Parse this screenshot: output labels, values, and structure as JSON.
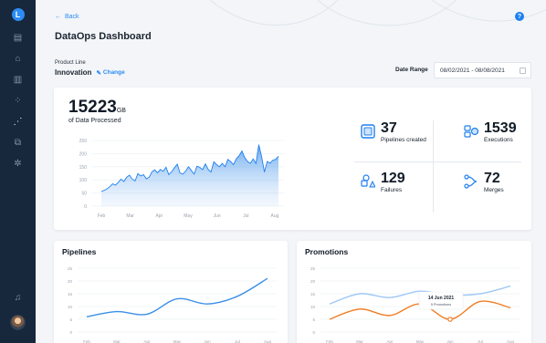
{
  "app": {
    "logo_letter": "L"
  },
  "sidebar": {
    "items": [
      {
        "icon": "document-icon",
        "glyph": "▤"
      },
      {
        "icon": "archive-icon",
        "glyph": "⌂"
      },
      {
        "icon": "analytics-icon",
        "glyph": "▥"
      },
      {
        "icon": "grid-icon",
        "glyph": "⁘"
      },
      {
        "icon": "chart-trend-icon",
        "glyph": "⋰",
        "active": true
      },
      {
        "icon": "network-icon",
        "glyph": "⧉"
      },
      {
        "icon": "settings-icon",
        "glyph": "✲"
      }
    ],
    "bottom": [
      {
        "icon": "bell-icon",
        "glyph": "♫"
      }
    ]
  },
  "header": {
    "back_label": "Back",
    "help_glyph": "?",
    "title": "DataOps Dashboard"
  },
  "filters": {
    "product_line_label": "Product Line",
    "product_line_value": "Innovation",
    "change_label": "Change",
    "date_range_label": "Date Range",
    "date_range_value": "08/02/2021 - 08/08/2021"
  },
  "summary": {
    "data_processed": "15223",
    "data_unit": "GB",
    "data_caption": "of Data Processed"
  },
  "stats": [
    {
      "value": "37",
      "label": "Pipelines created",
      "icon": "pipeline-icon"
    },
    {
      "value": "1539",
      "label": "Executions",
      "icon": "execution-icon"
    },
    {
      "value": "129",
      "label": "Failures",
      "icon": "failure-icon"
    },
    {
      "value": "72",
      "label": "Merges",
      "icon": "merge-icon"
    }
  ],
  "panels": {
    "pipelines_title": "Pipelines",
    "promotions_title": "Promotions",
    "tooltip_date": "14 Jun 2021",
    "tooltip_value": "5 Promotions"
  },
  "colors": {
    "accent": "#2c8cf4",
    "sidebar": "#17283c",
    "series_light": "#9ec9f5",
    "series_orange": "#f07e26"
  },
  "chart_data": [
    {
      "type": "area",
      "categories": [
        "Feb",
        "Mar",
        "Apr",
        "May",
        "Jun",
        "Jul",
        "Aug"
      ],
      "ylim": [
        0,
        250
      ],
      "yticks": [
        0,
        50,
        100,
        150,
        200,
        250
      ],
      "series": [
        {
          "values": [
            56,
            60,
            66,
            74,
            85,
            80,
            90,
            103,
            94,
            110,
            118,
            103,
            96,
            124,
            115,
            120,
            104,
            110,
            131,
            138,
            127,
            140,
            133,
            148,
            120,
            131,
            146,
            160,
            126,
            122,
            134,
            150,
            136,
            122,
            152,
            148,
            139,
            161,
            140,
            130,
            169,
            158,
            150,
            163,
            150,
            178,
            170,
            158,
            180,
            192,
            210,
            185,
            170,
            163,
            180,
            163,
            234,
            189,
            130,
            170,
            164,
            175,
            178,
            190
          ]
        }
      ]
    },
    {
      "type": "line",
      "title": "Pipelines",
      "categories": [
        "Feb",
        "Mar",
        "Apr",
        "May",
        "Jun",
        "Jul",
        "Aug"
      ],
      "ylim": [
        0,
        25
      ],
      "yticks": [
        0,
        5,
        10,
        15,
        20,
        25
      ],
      "series": [
        {
          "values": [
            6,
            8,
            7,
            13,
            11,
            14,
            21
          ]
        }
      ]
    },
    {
      "type": "line",
      "title": "Promotions",
      "categories": [
        "Feb",
        "Mar",
        "Apr",
        "May",
        "Jun",
        "Jul",
        "Aug"
      ],
      "ylim": [
        0,
        25
      ],
      "yticks": [
        0,
        5,
        10,
        15,
        20,
        25
      ],
      "series": [
        {
          "values": [
            11,
            15,
            13.5,
            16,
            14.5,
            15,
            18
          ]
        },
        {
          "values": [
            5,
            9,
            6.5,
            11,
            5,
            12,
            9.5
          ]
        }
      ]
    }
  ]
}
